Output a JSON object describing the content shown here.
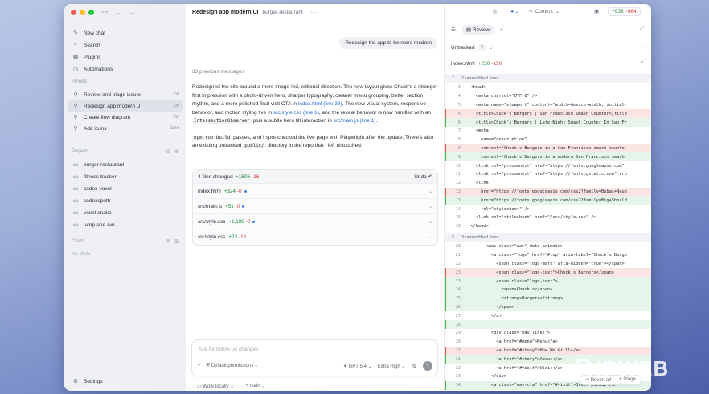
{
  "sidebar": {
    "top_items": [
      {
        "label": "New chat",
        "icon": "compose-icon"
      },
      {
        "label": "Search",
        "icon": "search-icon"
      },
      {
        "label": "Plugins",
        "icon": "grid-icon"
      },
      {
        "label": "Automations",
        "icon": "clock-icon"
      }
    ],
    "pinned_label": "Pinned",
    "pinned": [
      {
        "label": "Review and triage issues",
        "meta": "1w"
      },
      {
        "label": "Redesign app modern UI",
        "meta": "1w"
      },
      {
        "label": "Create flow diagram",
        "meta": "2w"
      },
      {
        "label": "Add icons",
        "meta": "1mo"
      }
    ],
    "projects_label": "Projects",
    "projects": [
      {
        "label": "burger-restaurant"
      },
      {
        "label": "fitness-tracker"
      },
      {
        "label": "codex-voxel"
      },
      {
        "label": "codexspottr"
      },
      {
        "label": "voxel-snake"
      },
      {
        "label": "jump-and-run"
      }
    ],
    "chats_label": "Chats",
    "no_chats": "No chats",
    "settings_label": "Settings"
  },
  "chat": {
    "title": "Redesign app modern UI",
    "project": "burger-restaurant",
    "user_message": "Redesign the app to be more modern",
    "previous_messages": "33 previous messages",
    "assistant": {
      "p1_a": "Redesigned the site around a more image-led, editorial direction. The new layout gives Chuck's a stronger first impression with a photo-driven hero, sharper typography, cleaner menu grouping, better section rhythm, and a more polished final visit CTA in ",
      "p1_link1": "index.html (line 38)",
      "p1_b": ". The new visual system, responsive behavior, and motion styling live in ",
      "p1_link2": "src/style.css (line 1)",
      "p1_c": ", and the reveal behavior is now handled with an ",
      "p1_code": "IntersectionObserver",
      "p1_d": " plus a subtle hero tilt interaction in ",
      "p1_link3": "src/main.js (line 1)",
      "p1_e": ".",
      "p2_code1": "npm run build",
      "p2_a": " passes, and I spot-checked the live page with Playwright after the update. There's also an existing untracked ",
      "p2_code2": "public/",
      "p2_b": " directory in the repo that I left untouched."
    },
    "files_changed": {
      "label": "4 files changed",
      "additions": "+1506",
      "deletions": "-16",
      "undo_label": "Undo",
      "files": [
        {
          "name": "index.html",
          "add": "+324",
          "del": "-0"
        },
        {
          "name": "src/main.js",
          "add": "+51",
          "del": "-0"
        },
        {
          "name": "src/style.css",
          "add": "+1,108",
          "del": "-0"
        },
        {
          "name": "src/style.css",
          "add": "+23",
          "del": "-16"
        }
      ]
    },
    "composer": {
      "placeholder": "Ask for follow-up changes",
      "permissions": "Default permissions",
      "model": "GPT-5.4",
      "effort": "Extra High"
    },
    "footer": {
      "work_mode": "Work locally",
      "branch": "main"
    }
  },
  "review": {
    "commit_label": "Commit",
    "stat_add": "+938",
    "stat_del": "-664",
    "tab_label": "Review",
    "untracked_label": "Untracked",
    "untracked_count": "4",
    "file_name": "index.html",
    "file_add": "+230",
    "file_del": "-150",
    "unmodified_top": "2 unmodified lines",
    "unmodified_mid": "3 unmodified lines",
    "lines_a": [
      {
        "n": "3",
        "t": "  <head>",
        "k": ""
      },
      {
        "n": "4",
        "t": "    <meta charset=\"UTF-8\" />",
        "k": ""
      },
      {
        "n": "5",
        "t": "    <meta name=\"viewport\" content=\"width=device-width, initial-",
        "k": ""
      },
      {
        "n": "6",
        "t": "    <title>Chuck's Burgers | San Francisco Smash Counter</title",
        "k": "del"
      },
      {
        "n": "6",
        "t": "    <title>Chuck's Burgers | Late-Night Smash Counter In San Fr",
        "k": "add"
      },
      {
        "n": "7",
        "t": "    <meta",
        "k": ""
      },
      {
        "n": "8",
        "t": "      name=\"description\"",
        "k": ""
      },
      {
        "n": "9",
        "t": "      content=\"Chuck's Burgers is a San Francisco smash counte",
        "k": "del"
      },
      {
        "n": "9",
        "t": "      content=\"Chuck's Burgers is a modern San Francisco smash",
        "k": "add"
      },
      {
        "n": "10",
        "t": "    <link rel=\"preconnect\" href=\"https://fonts.googleapis.com\"",
        "k": ""
      },
      {
        "n": "11",
        "t": "    <link rel=\"preconnect\" href=\"https://fonts.gstatic.com\" cro",
        "k": ""
      },
      {
        "n": "12",
        "t": "    <link",
        "k": ""
      },
      {
        "n": "13",
        "t": "      href=\"https://fonts.googleapis.com/css2?family=Bebas+Neue",
        "k": "del"
      },
      {
        "n": "13",
        "t": "      href=\"https://fonts.googleapis.com/css2?family=Big+Should",
        "k": "add"
      },
      {
        "n": "14",
        "t": "      rel=\"stylesheet\" />",
        "k": ""
      },
      {
        "n": "15",
        "t": "    <link rel=\"stylesheet\" href=\"/src/style.css\" />",
        "k": ""
      },
      {
        "n": "16",
        "t": "  </head>",
        "k": ""
      }
    ],
    "lines_b": [
      {
        "n": "20",
        "t": "        <nav class=\"nav\" data-animate>",
        "k": ""
      },
      {
        "n": "21",
        "t": "          <a class=\"logo\" href=\"#top\" aria-label=\"Chuck's Burge",
        "k": ""
      },
      {
        "n": "22",
        "t": "            <span class=\"logo-mark\" aria-hidden=\"true\"></span>",
        "k": ""
      },
      {
        "n": "23",
        "t": "            <span class=\"logo-text\">Chuck's Burgers</span>",
        "k": "del"
      },
      {
        "n": "23",
        "t": "            <span class=\"logo-text\">",
        "k": "add"
      },
      {
        "n": "24",
        "t": "              <span>Chuck's</span>",
        "k": "add"
      },
      {
        "n": "25",
        "t": "              <strong>Burgers</strong>",
        "k": "add"
      },
      {
        "n": "26",
        "t": "            </span>",
        "k": "add"
      },
      {
        "n": "27",
        "t": "          </a>",
        "k": ""
      },
      {
        "n": "28",
        "t": "",
        "k": "add"
      },
      {
        "n": "29",
        "t": "          <div class=\"nav-links\">",
        "k": ""
      },
      {
        "n": "30",
        "t": "            <a href=\"#menu\">Menu</a>",
        "k": ""
      },
      {
        "n": "27",
        "t": "            <a href=\"#story\">How We Grill</a>",
        "k": "del"
      },
      {
        "n": "31",
        "t": "            <a href=\"#story\">About</a>",
        "k": "add"
      },
      {
        "n": "32",
        "t": "            <a href=\"#visit\">Visit</a>",
        "k": ""
      },
      {
        "n": "33",
        "t": "          </div>",
        "k": ""
      },
      {
        "n": "34",
        "t": "          <a class=\"nav-cta\" href=\"#visit\">Order pickup</a>",
        "k": "add"
      }
    ],
    "float_revert": "Revert all",
    "float_stage": "Stage"
  },
  "watermark": "IPWEB"
}
